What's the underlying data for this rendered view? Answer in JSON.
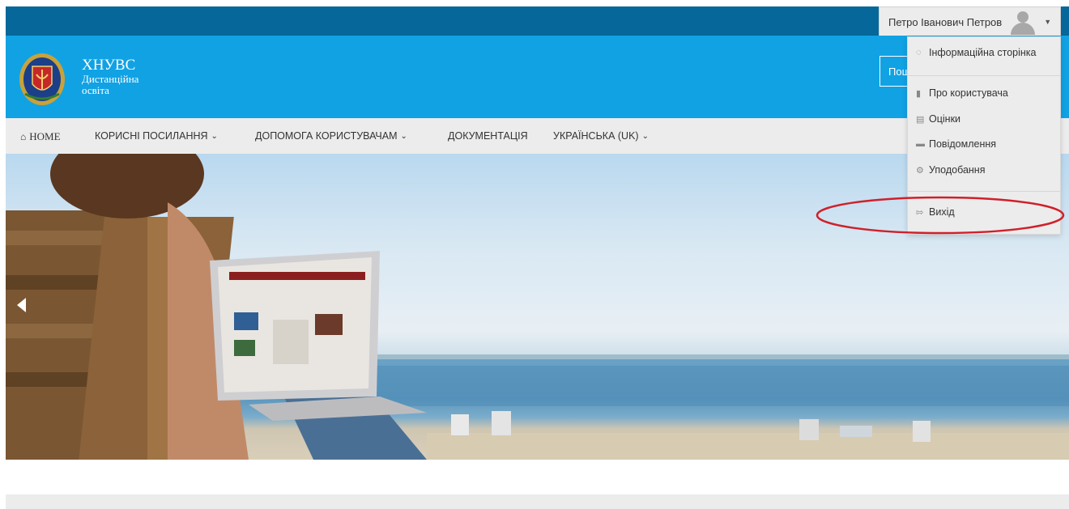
{
  "topbar": {
    "user_name": "Петро Іванович Петров",
    "avatar_icon": "user-avatar-icon",
    "caret_icon": "caret-down-icon"
  },
  "header": {
    "logo_line1": "ХНУВС",
    "logo_line2": "Дистанційна",
    "logo_line3": "освіта",
    "search_button_label": "Пош",
    "colors": {
      "topbar": "#06679a",
      "header": "#11a2e4",
      "navbar": "#ececec"
    }
  },
  "nav": {
    "items": [
      {
        "label": "HOME",
        "icon": "home-icon"
      },
      {
        "label": "КОРИСНІ ПОСИЛАННЯ",
        "icon": "chevron-down-icon"
      },
      {
        "label": "ДОПОМОГА КОРИСТУВАЧАМ",
        "icon": "chevron-down-icon"
      },
      {
        "label": "ДОКУМЕНТАЦІЯ"
      },
      {
        "label": "УКРАЇНСЬКА (UK)",
        "icon": "chevron-down-icon"
      }
    ]
  },
  "user_dropdown": {
    "items": [
      {
        "label": "Інформаційна сторінка",
        "icon": "dashboard-icon"
      },
      {
        "label": "Про користувача",
        "icon": "user-icon"
      },
      {
        "label": "Оцінки",
        "icon": "grades-icon"
      },
      {
        "label": "Повідомлення",
        "icon": "message-icon"
      },
      {
        "label": "Уподобання",
        "icon": "gear-icon"
      },
      {
        "label": "Вихід",
        "icon": "logout-icon"
      }
    ],
    "highlight_color": "#d0202a"
  },
  "hero": {
    "prev_icon": "arrow-left-icon"
  }
}
